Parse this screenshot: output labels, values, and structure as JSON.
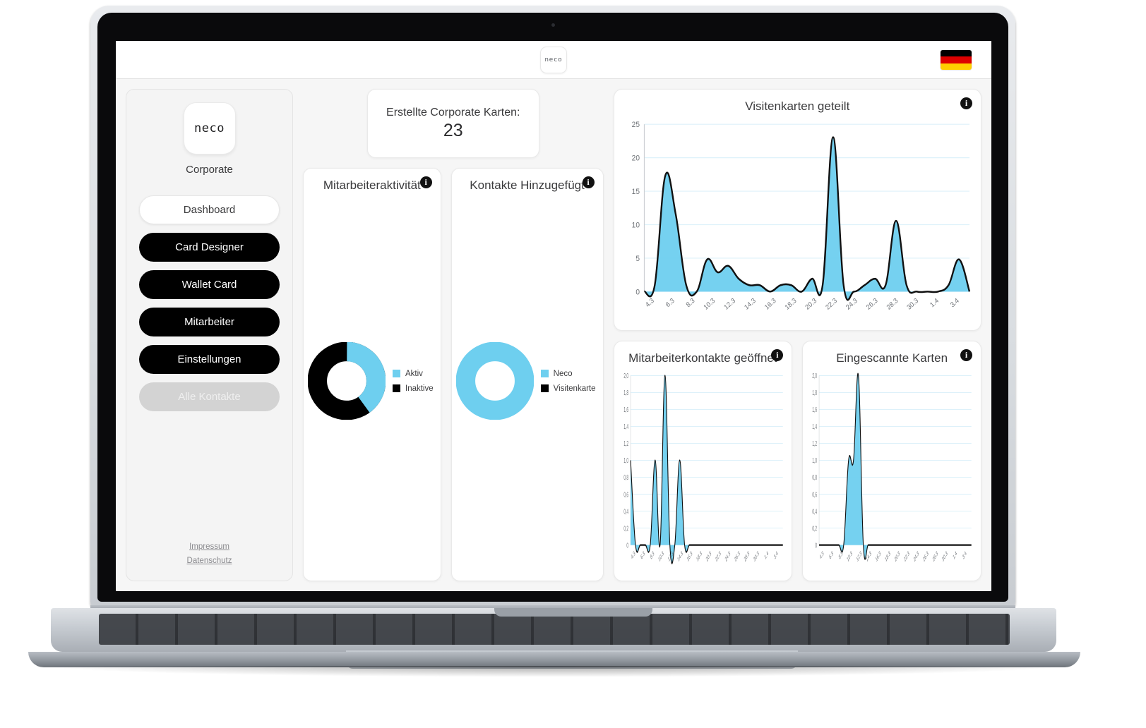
{
  "header": {
    "logo_text": "neco",
    "logo_icon": "neco-logo",
    "flag_name": "german-flag",
    "flag_colors": [
      "#000000",
      "#DD0000",
      "#FFCE00"
    ]
  },
  "sidebar": {
    "brand_logo_text": "neco",
    "brand_label": "Corporate",
    "items": [
      {
        "label": "Dashboard",
        "state": "active"
      },
      {
        "label": "Card Designer",
        "state": "dark"
      },
      {
        "label": "Wallet Card",
        "state": "dark"
      },
      {
        "label": "Mitarbeiter",
        "state": "dark"
      },
      {
        "label": "Einstellungen",
        "state": "dark"
      },
      {
        "label": "Alle Kontakte",
        "state": "disabled"
      }
    ],
    "footer_links": [
      {
        "label": "Impressum"
      },
      {
        "label": "Datenschutz"
      }
    ]
  },
  "stat_card": {
    "label": "Erstellte Corporate Karten:",
    "value": "23"
  },
  "info_glyph": "i",
  "colors": {
    "accent_blue": "#6ECFEF",
    "dark": "#000000",
    "grid": "#ddf1fa",
    "line": "#111111"
  },
  "chart_data": [
    {
      "id": "mitarbeiteraktivitaet",
      "type": "pie",
      "title": "Mitarbeiteraktivität",
      "legend_position": "right",
      "labels": [
        "Aktiv",
        "Inaktive"
      ],
      "values": [
        40,
        60
      ],
      "colors": [
        "#6ECFEF",
        "#000000"
      ]
    },
    {
      "id": "kontakte-hinzugefuegt",
      "type": "pie",
      "title": "Kontakte Hinzugefügt",
      "legend_position": "right",
      "labels": [
        "Neco",
        "Visitenkarte"
      ],
      "values": [
        100,
        0
      ],
      "colors": [
        "#6ECFEF",
        "#000000"
      ]
    },
    {
      "id": "visitenkarten-geteilt",
      "type": "area",
      "title": "Visitenkarten geteilt",
      "xlabel": "",
      "ylabel": "",
      "ylim": [
        0,
        26
      ],
      "yticks": [
        0,
        5,
        10,
        15,
        20,
        25
      ],
      "grid": true,
      "xticks": [
        "4.3",
        "6.3",
        "8.3",
        "10.3",
        "12.3",
        "14.3",
        "16.3",
        "18.3",
        "20.3",
        "22.3",
        "24.3",
        "26.3",
        "28.3",
        "30.3",
        "1.4",
        "3.4"
      ],
      "x": [
        "3.3",
        "4.3",
        "5.3",
        "6.3",
        "7.3",
        "8.3",
        "9.3",
        "10.3",
        "11.3",
        "12.3",
        "13.3",
        "14.3",
        "15.3",
        "16.3",
        "17.3",
        "18.3",
        "19.3",
        "20.3",
        "21.3",
        "22.3",
        "23.3",
        "24.3",
        "25.3",
        "26.3",
        "27.3",
        "28.3",
        "29.3",
        "30.3",
        "31.3",
        "1.4",
        "2.4",
        "3.4"
      ],
      "values": [
        0,
        1,
        18,
        12,
        1,
        0,
        5,
        3,
        4,
        2,
        1,
        1,
        0,
        1,
        1,
        0,
        2,
        1,
        24,
        1,
        0,
        1,
        2,
        1,
        11,
        1,
        0,
        0,
        0,
        1,
        5,
        0
      ]
    },
    {
      "id": "mitarbeiterkontakte-geoeffnet",
      "type": "area",
      "title": "Mitarbeiterkontakte geöffnet",
      "xlabel": "",
      "ylabel": "",
      "ylim": [
        0,
        2.0
      ],
      "yticks": [
        "0",
        "0,2",
        "0,4",
        "0,6",
        "0,8",
        "1,0",
        "1,2",
        "1,4",
        "1,6",
        "1,8",
        "2,0"
      ],
      "grid": true,
      "xticks": [
        "4.3",
        "6.3",
        "8.3",
        "10.3",
        "12.3",
        "14.3",
        "16.3",
        "18.3",
        "20.3",
        "22.3",
        "24.3",
        "26.3",
        "28.3",
        "30.3",
        "1.4",
        "3.4"
      ],
      "x": [
        "3.3",
        "4.3",
        "5.3",
        "6.3",
        "7.3",
        "8.3",
        "9.3",
        "10.3",
        "11.3",
        "12.3",
        "13.3",
        "14.3",
        "15.3",
        "16.3",
        "17.3",
        "18.3",
        "19.3",
        "20.3",
        "21.3",
        "22.3",
        "23.3",
        "24.3",
        "25.3",
        "26.3",
        "27.3",
        "28.3",
        "29.3",
        "30.3",
        "31.3",
        "1.4",
        "2.4",
        "3.4"
      ],
      "values": [
        1,
        0,
        0,
        0,
        0,
        1,
        0,
        2,
        0,
        0,
        1,
        0,
        0,
        0,
        0,
        0,
        0,
        0,
        0,
        0,
        0,
        0,
        0,
        0,
        0,
        0,
        0,
        0,
        0,
        0,
        0,
        0
      ]
    },
    {
      "id": "eingescannte-karten",
      "type": "area",
      "title": "Eingescannte Karten",
      "xlabel": "",
      "ylabel": "",
      "ylim": [
        0,
        2.0
      ],
      "yticks": [
        "0",
        "0,2",
        "0,4",
        "0,6",
        "0,8",
        "1,0",
        "1,2",
        "1,4",
        "1,6",
        "1,8",
        "2,0"
      ],
      "grid": true,
      "xticks": [
        "4.3",
        "6.3",
        "8.3",
        "10.3",
        "12.3",
        "14.3",
        "16.3",
        "18.3",
        "20.3",
        "22.3",
        "24.3",
        "26.3",
        "28.3",
        "30.3",
        "1.4",
        "3.4"
      ],
      "x": [
        "3.3",
        "4.3",
        "5.3",
        "6.3",
        "7.3",
        "8.3",
        "9.3",
        "10.3",
        "11.3",
        "12.3",
        "13.3",
        "14.3",
        "15.3",
        "16.3",
        "17.3",
        "18.3",
        "19.3",
        "20.3",
        "21.3",
        "22.3",
        "23.3",
        "24.3",
        "25.3",
        "26.3",
        "27.3",
        "28.3",
        "29.3",
        "30.3",
        "31.3",
        "1.4",
        "2.4",
        "3.4"
      ],
      "values": [
        0,
        0,
        0,
        0,
        0,
        0,
        1,
        1,
        2,
        0,
        0,
        0,
        0,
        0,
        0,
        0,
        0,
        0,
        0,
        0,
        0,
        0,
        0,
        0,
        0,
        0,
        0,
        0,
        0,
        0,
        0,
        0
      ]
    }
  ]
}
